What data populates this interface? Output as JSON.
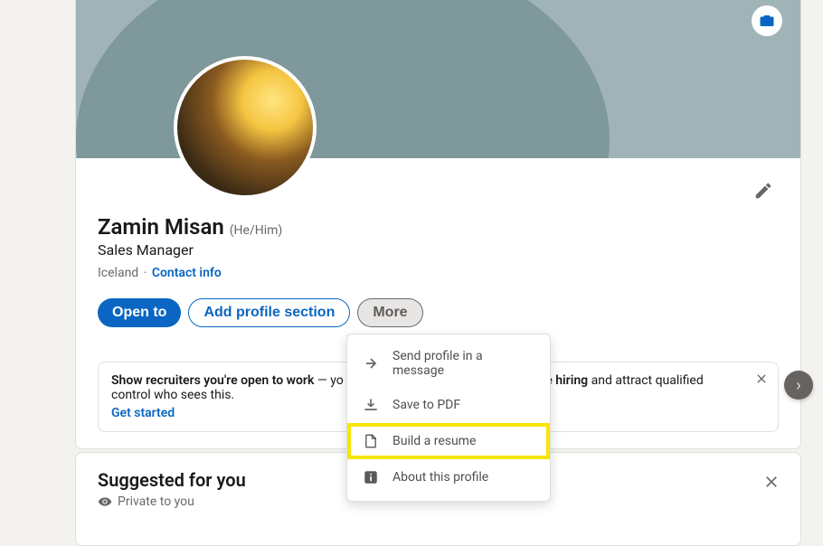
{
  "profile": {
    "name": "Zamin Misan",
    "pronouns": "(He/Him)",
    "headline": "Sales Manager",
    "location": "Iceland",
    "contact_link": "Contact info"
  },
  "actions": {
    "open_to": "Open to",
    "add_section": "Add profile section",
    "more": "More"
  },
  "open_card": {
    "prefix_bold": "Show recruiters you're open to work",
    "mid": " — yo",
    "suffix_bold": "e hiring",
    "suffix_plain": " and attract qualified control who sees this.",
    "cta": "Get started"
  },
  "dropdown": {
    "send": "Send profile in a message",
    "save_pdf": "Save to PDF",
    "build_resume": "Build a resume",
    "about": "About this profile"
  },
  "suggested": {
    "title": "Suggested for you",
    "private": "Private to you"
  }
}
